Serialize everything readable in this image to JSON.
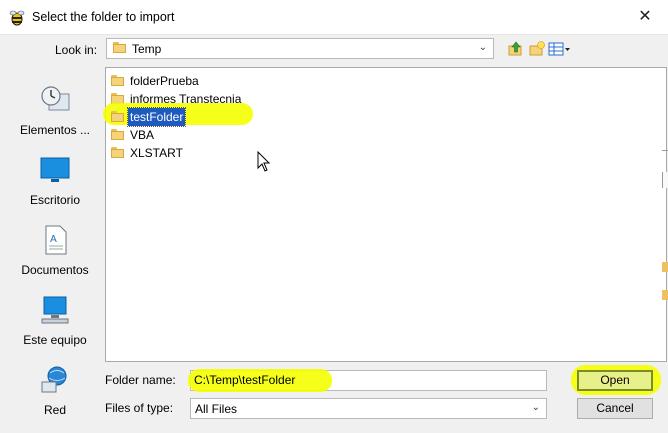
{
  "window": {
    "title": "Select the folder to import",
    "close_glyph": "✕"
  },
  "look_in": {
    "label": "Look in:",
    "value": "Temp",
    "tools": [
      "up-folder-icon",
      "new-folder-icon",
      "view-menu-icon"
    ]
  },
  "places": [
    {
      "label": "Elementos ...",
      "icon": "recent-items-icon"
    },
    {
      "label": "Escritorio",
      "icon": "desktop-icon"
    },
    {
      "label": "Documentos",
      "icon": "documents-icon"
    },
    {
      "label": "Este equipo",
      "icon": "computer-icon"
    },
    {
      "label": "Red",
      "icon": "network-icon"
    }
  ],
  "files": [
    {
      "name": "folderPrueba",
      "selected": false
    },
    {
      "name": "informes Transtecnia",
      "selected": false
    },
    {
      "name": "testFolder",
      "selected": true
    },
    {
      "name": "VBA",
      "selected": false
    },
    {
      "name": "XLSTART",
      "selected": false
    }
  ],
  "form": {
    "folder_name_label": "Folder name:",
    "folder_name_value": "C:\\Temp\\testFolder",
    "files_of_type_label": "Files of type:",
    "files_of_type_value": "All Files"
  },
  "buttons": {
    "open": "Open",
    "cancel": "Cancel"
  },
  "colors": {
    "highlight": "#f4ff00",
    "selection": "#1f5bbf"
  }
}
